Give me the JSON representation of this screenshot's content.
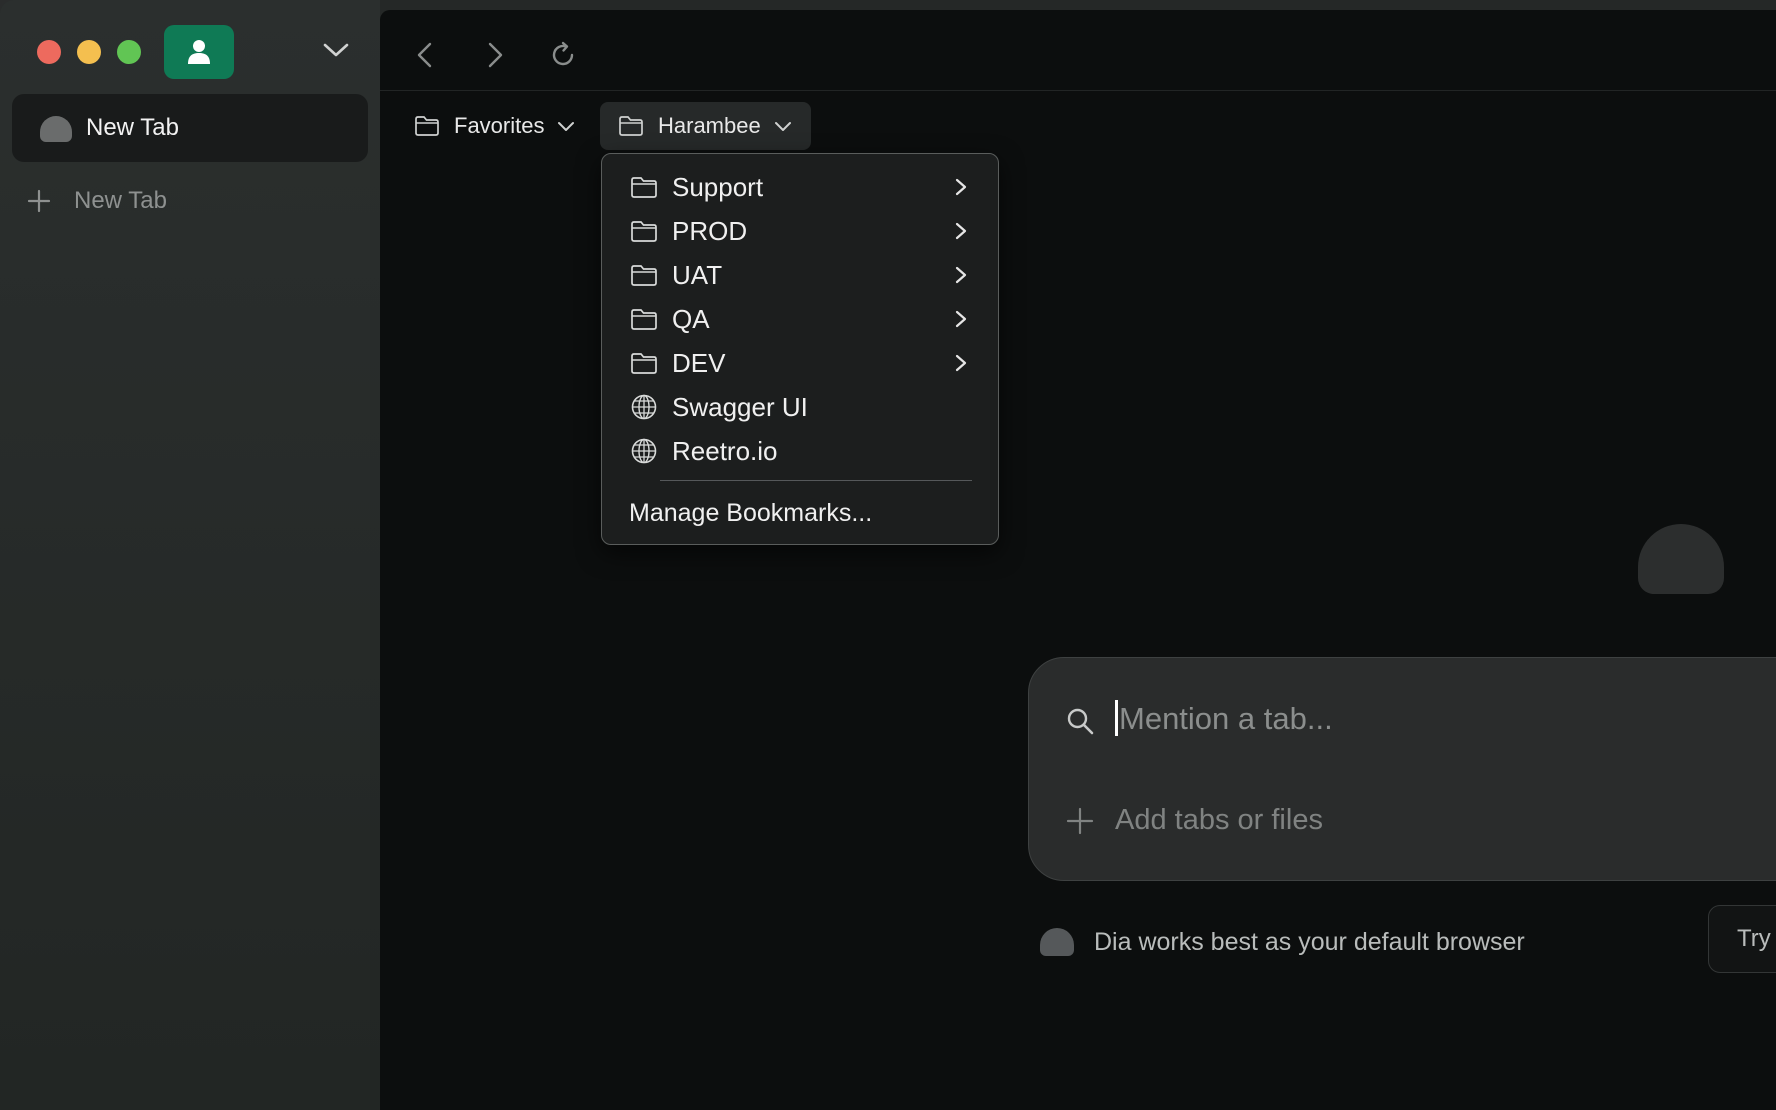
{
  "sidebar": {
    "traffic_lights": {
      "close": "#ed6a5e",
      "minimize": "#f4bf4f",
      "zoom": "#61c554"
    },
    "profile_color": "#0f7a55",
    "profile_icon": "person-icon",
    "active_tab": {
      "label": "New Tab"
    },
    "new_tab_label": "New Tab"
  },
  "toolbar": {
    "back_icon": "chevron-left-icon",
    "forward_icon": "chevron-right-icon",
    "reload_icon": "reload-icon"
  },
  "bookmarks_bar": {
    "items": [
      {
        "label": "Favorites",
        "icon": "folder-icon"
      },
      {
        "label": "Harambee",
        "icon": "folder-icon"
      }
    ]
  },
  "dropdown": {
    "items": [
      {
        "label": "Support",
        "icon": "folder-icon",
        "submenu": true
      },
      {
        "label": "PROD",
        "icon": "folder-icon",
        "submenu": true
      },
      {
        "label": "UAT",
        "icon": "folder-icon",
        "submenu": true
      },
      {
        "label": "QA",
        "icon": "folder-icon",
        "submenu": true
      },
      {
        "label": "DEV",
        "icon": "folder-icon",
        "submenu": true
      },
      {
        "label": "Swagger UI",
        "icon": "globe-icon",
        "submenu": false
      },
      {
        "label": "Reetro.io",
        "icon": "globe-icon",
        "submenu": false
      }
    ],
    "manage_label": "Manage Bookmarks..."
  },
  "mention": {
    "placeholder": "Mention a tab...",
    "add_label": "Add tabs or files"
  },
  "default_browser": {
    "text": "Dia works best as your default browser",
    "button_label": "Try"
  }
}
